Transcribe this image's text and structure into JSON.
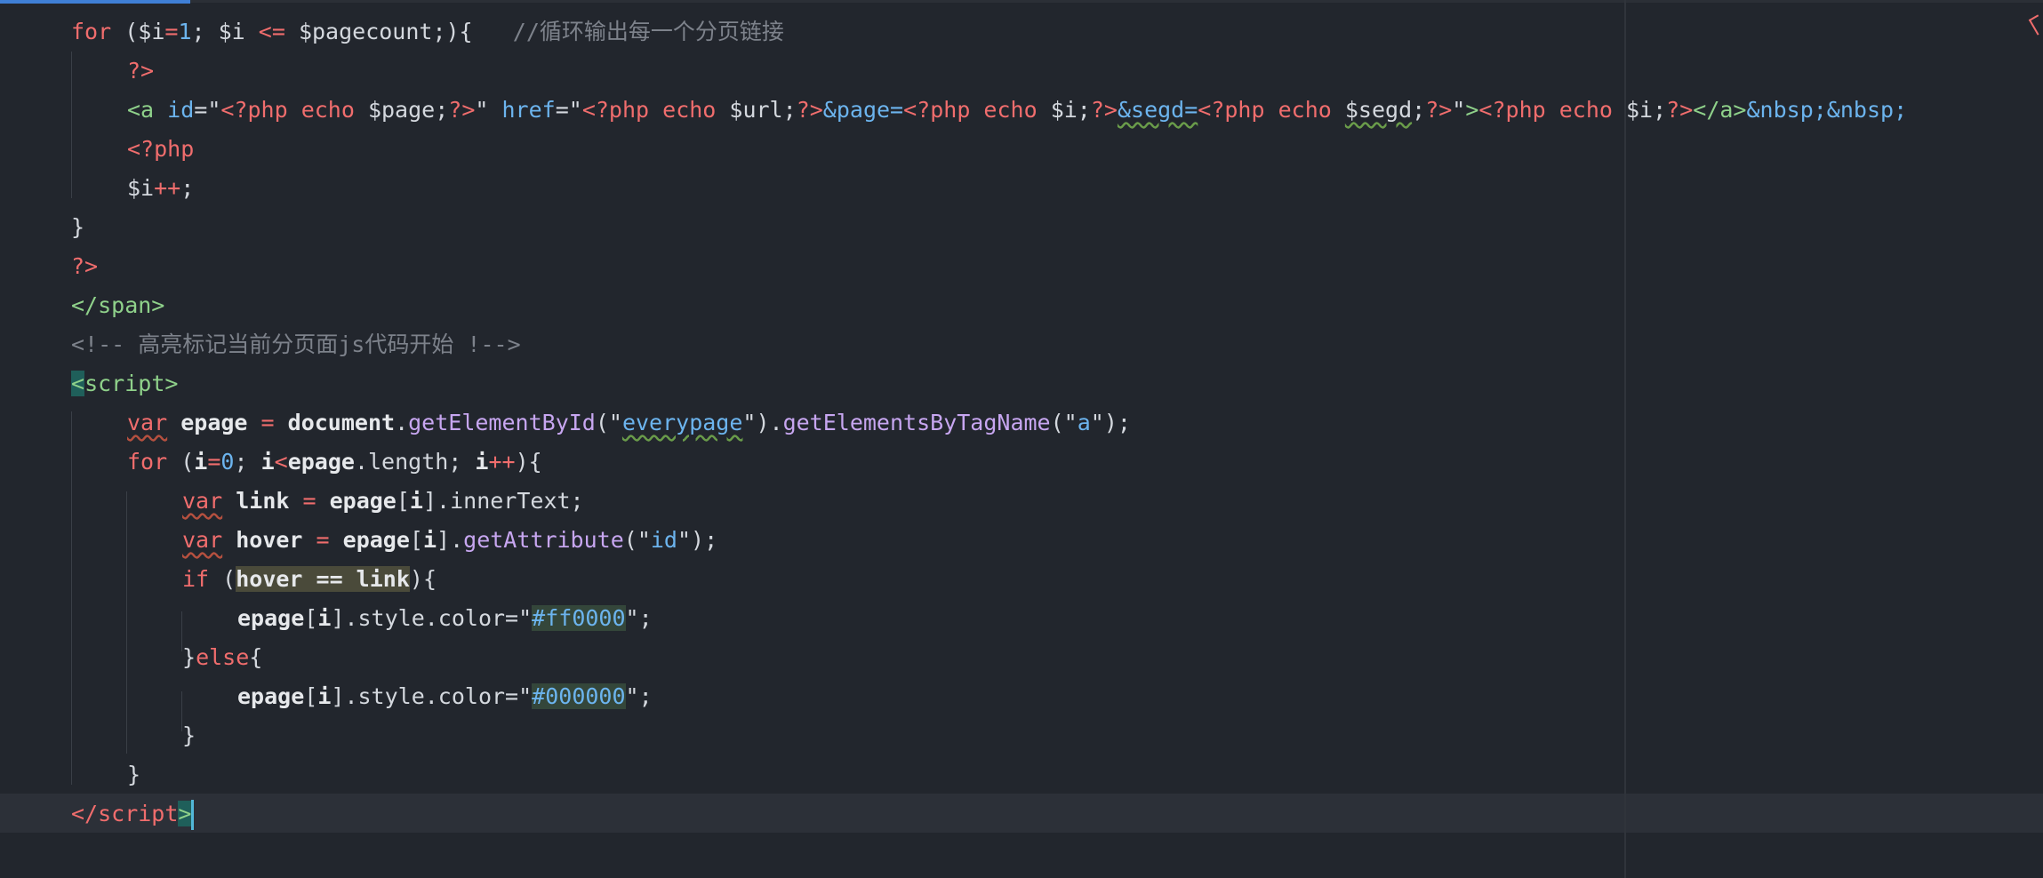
{
  "editor": {
    "lines": [
      {
        "indent": 0,
        "tokens": [
          {
            "t": "for",
            "c": "kw"
          },
          {
            "t": " (",
            "c": "pun"
          },
          {
            "t": "$i",
            "c": "var"
          },
          {
            "t": "=",
            "c": "op"
          },
          {
            "t": "1",
            "c": "num"
          },
          {
            "t": "; ",
            "c": "pun"
          },
          {
            "t": "$i",
            "c": "var"
          },
          {
            "t": " <= ",
            "c": "op"
          },
          {
            "t": "$pagecount",
            "c": "var"
          },
          {
            "t": ";){",
            "c": "pun"
          },
          {
            "t": "   //循环输出每一个分页链接",
            "c": "cm"
          }
        ]
      },
      {
        "indent": 1,
        "tokens": [
          {
            "t": "?>",
            "c": "kw"
          }
        ]
      },
      {
        "indent": 1,
        "tokens": [
          {
            "t": "<a",
            "c": "tag"
          },
          {
            "t": " id",
            "c": "attr"
          },
          {
            "t": "=\"",
            "c": "pun"
          },
          {
            "t": "<?php",
            "c": "str"
          },
          {
            "t": " echo ",
            "c": "str"
          },
          {
            "t": "$page",
            "c": "var"
          },
          {
            "t": ";",
            "c": "pun"
          },
          {
            "t": "?>",
            "c": "str"
          },
          {
            "t": "\"",
            "c": "pun"
          },
          {
            "t": " href",
            "c": "attr"
          },
          {
            "t": "=\"",
            "c": "pun"
          },
          {
            "t": "<?php",
            "c": "str"
          },
          {
            "t": " echo ",
            "c": "str"
          },
          {
            "t": "$url",
            "c": "var"
          },
          {
            "t": ";",
            "c": "pun"
          },
          {
            "t": "?>",
            "c": "str"
          },
          {
            "t": "&page=",
            "c": "ent"
          },
          {
            "t": "<?php",
            "c": "str"
          },
          {
            "t": " echo ",
            "c": "str"
          },
          {
            "t": "$i",
            "c": "var"
          },
          {
            "t": ";",
            "c": "pun"
          },
          {
            "t": "?>",
            "c": "str"
          },
          {
            "t": "&segd=",
            "c": "ent",
            "w": "g"
          },
          {
            "t": "<?php",
            "c": "str"
          },
          {
            "t": " echo ",
            "c": "str"
          },
          {
            "t": "$segd",
            "c": "var",
            "w": "g"
          },
          {
            "t": ";",
            "c": "pun"
          },
          {
            "t": "?>",
            "c": "str"
          },
          {
            "t": "\"",
            "c": "pun"
          },
          {
            "t": ">",
            "c": "tag"
          },
          {
            "t": "<?php",
            "c": "str"
          },
          {
            "t": " echo ",
            "c": "str"
          },
          {
            "t": "$i",
            "c": "var"
          },
          {
            "t": ";",
            "c": "pun"
          },
          {
            "t": "?>",
            "c": "str"
          },
          {
            "t": "</a>",
            "c": "tag"
          },
          {
            "t": "&nbsp;&nbsp;",
            "c": "ent"
          }
        ]
      },
      {
        "indent": 1,
        "tokens": [
          {
            "t": "<?php",
            "c": "kw"
          }
        ]
      },
      {
        "indent": 1,
        "tokens": [
          {
            "t": "$i",
            "c": "var"
          },
          {
            "t": "++",
            "c": "op"
          },
          {
            "t": ";",
            "c": "pun"
          }
        ]
      },
      {
        "indent": 0,
        "tokens": [
          {
            "t": "}",
            "c": "pun"
          }
        ]
      },
      {
        "indent": 0,
        "tokens": [
          {
            "t": "?>",
            "c": "kw"
          }
        ]
      },
      {
        "indent": 0,
        "tokens": [
          {
            "t": "</span>",
            "c": "tag"
          }
        ]
      },
      {
        "indent": 0,
        "tokens": [
          {
            "t": "<!-- 高亮标记当前分页面js代码开始 !-->",
            "c": "cm"
          }
        ]
      },
      {
        "indent": 0,
        "tokens": [
          {
            "t": "<",
            "c": "tag-hl"
          },
          {
            "t": "script",
            "c": "tag"
          },
          {
            "t": ">",
            "c": "tag"
          }
        ]
      },
      {
        "indent": 1,
        "tokens": [
          {
            "t": "var",
            "c": "kw",
            "w": "r"
          },
          {
            "t": " ",
            "c": "pun"
          },
          {
            "t": "epage",
            "c": "ident"
          },
          {
            "t": " = ",
            "c": "op"
          },
          {
            "t": "document",
            "c": "ident"
          },
          {
            "t": ".",
            "c": "pun"
          },
          {
            "t": "getElementById",
            "c": "fn"
          },
          {
            "t": "(\"",
            "c": "pun"
          },
          {
            "t": "everypage",
            "c": "strv",
            "w": "g"
          },
          {
            "t": "\").",
            "c": "pun"
          },
          {
            "t": "getElementsByTagName",
            "c": "fn"
          },
          {
            "t": "(\"",
            "c": "pun"
          },
          {
            "t": "a",
            "c": "strv"
          },
          {
            "t": "\");",
            "c": "pun"
          }
        ]
      },
      {
        "indent": 1,
        "tokens": [
          {
            "t": "for",
            "c": "kw"
          },
          {
            "t": " (",
            "c": "pun"
          },
          {
            "t": "i",
            "c": "ident"
          },
          {
            "t": "=",
            "c": "op"
          },
          {
            "t": "0",
            "c": "num"
          },
          {
            "t": "; ",
            "c": "pun"
          },
          {
            "t": "i",
            "c": "ident"
          },
          {
            "t": "<",
            "c": "op"
          },
          {
            "t": "epage",
            "c": "ident"
          },
          {
            "t": ".length; ",
            "c": "prop"
          },
          {
            "t": "i",
            "c": "ident"
          },
          {
            "t": "++",
            "c": "op"
          },
          {
            "t": "){",
            "c": "pun"
          }
        ]
      },
      {
        "indent": 2,
        "tokens": [
          {
            "t": "var",
            "c": "kw",
            "w": "r"
          },
          {
            "t": " ",
            "c": "pun"
          },
          {
            "t": "link",
            "c": "ident"
          },
          {
            "t": " = ",
            "c": "op"
          },
          {
            "t": "epage",
            "c": "ident"
          },
          {
            "t": "[",
            "c": "pun"
          },
          {
            "t": "i",
            "c": "ident"
          },
          {
            "t": "].innerText;",
            "c": "prop"
          }
        ]
      },
      {
        "indent": 2,
        "tokens": [
          {
            "t": "var",
            "c": "kw",
            "w": "r"
          },
          {
            "t": " ",
            "c": "pun"
          },
          {
            "t": "hover",
            "c": "ident"
          },
          {
            "t": " = ",
            "c": "op"
          },
          {
            "t": "epage",
            "c": "ident"
          },
          {
            "t": "[",
            "c": "pun"
          },
          {
            "t": "i",
            "c": "ident"
          },
          {
            "t": "].",
            "c": "pun"
          },
          {
            "t": "getAttribute",
            "c": "fn"
          },
          {
            "t": "(\"",
            "c": "pun"
          },
          {
            "t": "id",
            "c": "strv"
          },
          {
            "t": "\");",
            "c": "pun"
          }
        ]
      },
      {
        "indent": 2,
        "tokens": [
          {
            "t": "if",
            "c": "kw"
          },
          {
            "t": " (",
            "c": "pun"
          },
          {
            "t": "hover == link",
            "c": "ident",
            "h": true
          },
          {
            "t": "){",
            "c": "pun"
          }
        ]
      },
      {
        "indent": 3,
        "tokens": [
          {
            "t": "epage",
            "c": "ident"
          },
          {
            "t": "[",
            "c": "pun"
          },
          {
            "t": "i",
            "c": "ident"
          },
          {
            "t": "].style.color=\"",
            "c": "prop"
          },
          {
            "t": "#ff0000",
            "c": "hex"
          },
          {
            "t": "\";",
            "c": "pun"
          }
        ]
      },
      {
        "indent": 2,
        "tokens": [
          {
            "t": "}",
            "c": "pun"
          },
          {
            "t": "else",
            "c": "kw"
          },
          {
            "t": "{",
            "c": "pun"
          }
        ]
      },
      {
        "indent": 3,
        "tokens": [
          {
            "t": "epage",
            "c": "ident"
          },
          {
            "t": "[",
            "c": "pun"
          },
          {
            "t": "i",
            "c": "ident"
          },
          {
            "t": "].style.color=\"",
            "c": "prop"
          },
          {
            "t": "#000000",
            "c": "hex"
          },
          {
            "t": "\";",
            "c": "pun"
          }
        ]
      },
      {
        "indent": 2,
        "tokens": [
          {
            "t": "}",
            "c": "pun"
          }
        ]
      },
      {
        "indent": 1,
        "tokens": [
          {
            "t": "}",
            "c": "pun"
          }
        ]
      },
      {
        "indent": 0,
        "caret": true,
        "tokens": [
          {
            "t": "</script",
            "c": "kw"
          },
          {
            "t": ">",
            "c": "blink"
          }
        ]
      }
    ]
  }
}
